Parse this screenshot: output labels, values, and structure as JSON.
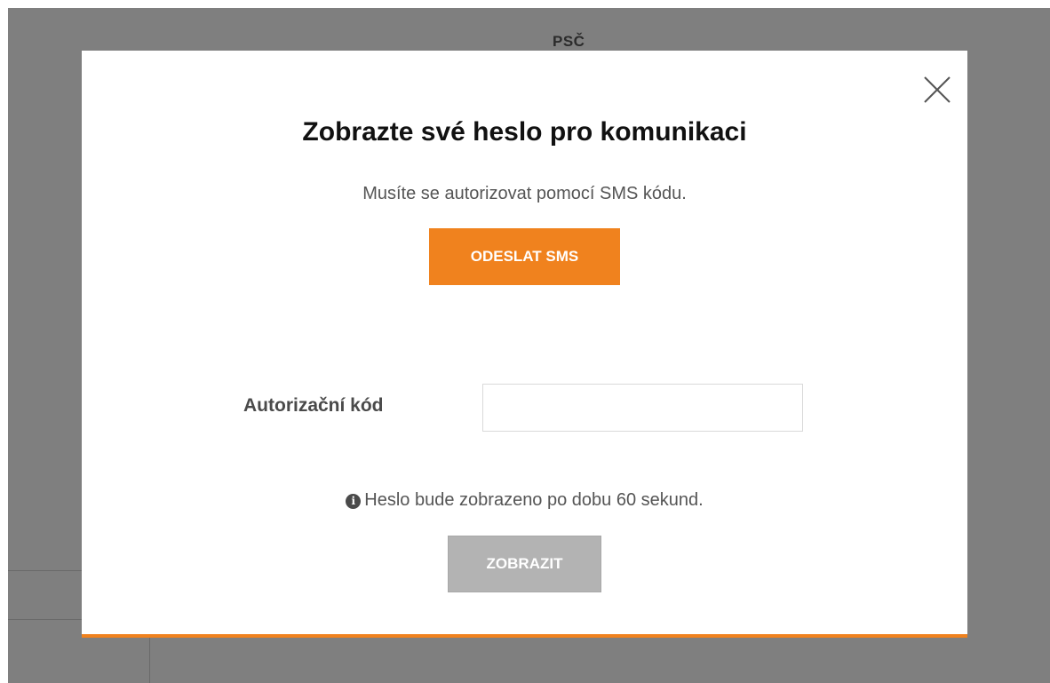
{
  "background": {
    "field_label": "PSČ"
  },
  "modal": {
    "title": "Zobrazte své heslo pro komunikaci",
    "subtitle": "Musíte se autorizovat pomocí SMS kódu.",
    "send_sms_label": "ODESLAT SMS",
    "code_label": "Autorizační kód",
    "code_value": "",
    "code_placeholder": "",
    "info_text": "Heslo bude zobrazeno po dobu 60 sekund.",
    "show_label": "ZOBRAZIT",
    "close_icon": "close-icon",
    "info_icon": "info-circle-icon"
  },
  "colors": {
    "accent": "#f0821e",
    "overlay": "#7f7f7f",
    "disabled_button": "#b3b3b3"
  }
}
